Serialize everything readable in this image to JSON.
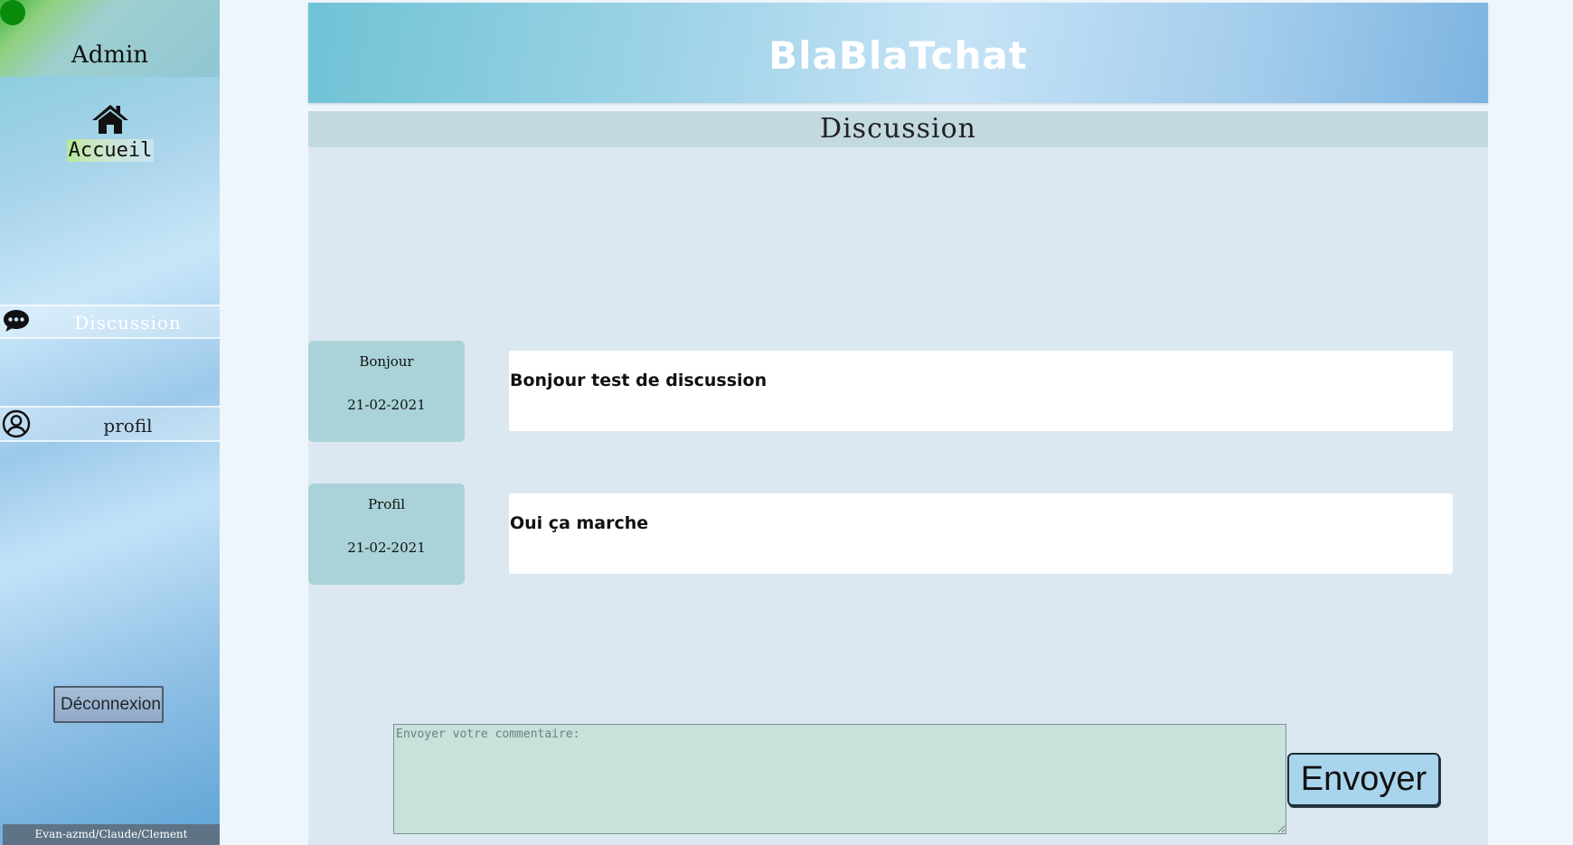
{
  "sidebar": {
    "user_title": "Admin",
    "home_label": "Accueil",
    "items": [
      {
        "label": "Discussion",
        "icon": "chat-bubble-icon"
      },
      {
        "label": "profil",
        "icon": "user-circle-icon"
      }
    ],
    "logout_label": "Déconnexion",
    "credits": "Evan-azmd/Claude/Clement",
    "status_color": "#0a8a0a"
  },
  "header": {
    "app_title": "BlaBlaTchat"
  },
  "main": {
    "section_title": "Discussion",
    "messages": [
      {
        "author": "Bonjour",
        "date": "21-02-2021",
        "text": "Bonjour test de discussion"
      },
      {
        "author": "Profil",
        "date": "21-02-2021",
        "text": "Oui ça marche"
      }
    ],
    "comment": {
      "placeholder": "Envoyer votre commentaire:",
      "value": ""
    },
    "send_label": "Envoyer"
  }
}
